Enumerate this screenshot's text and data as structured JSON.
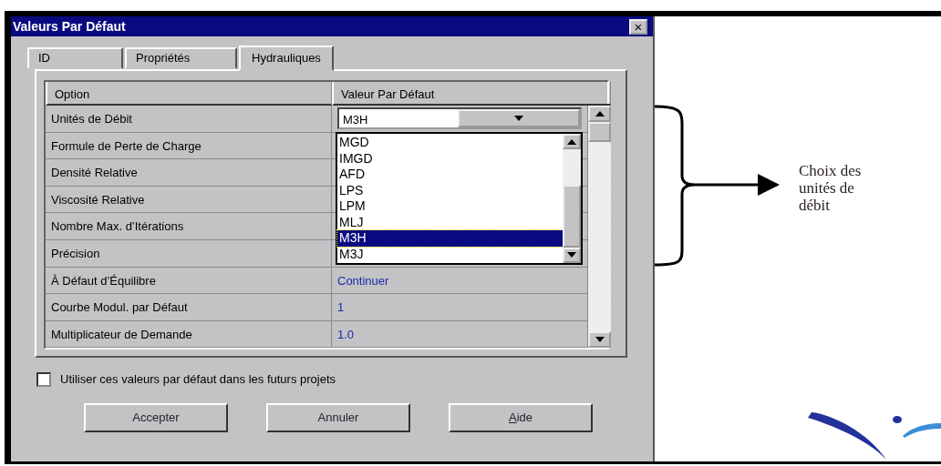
{
  "window": {
    "title": "Valeurs Par Défaut",
    "close": "×"
  },
  "tabs": [
    {
      "label": "ID",
      "selected": false
    },
    {
      "label": "Propriétés",
      "selected": false
    },
    {
      "label": "Hydrauliques",
      "selected": true
    }
  ],
  "grid": {
    "columns": [
      "Option",
      "Valeur Par Défaut"
    ],
    "rows": [
      {
        "option": "Unités de Débit",
        "value": "M3H",
        "kind": "combo"
      },
      {
        "option": "Formule de Perte de Charge"
      },
      {
        "option": "Densité Relative"
      },
      {
        "option": "Viscosité Relative"
      },
      {
        "option": "Nombre Max. d’Itérations"
      },
      {
        "option": "Précision"
      },
      {
        "option": "À Défaut d’Équilibre",
        "value": "Continuer",
        "kind": "text"
      },
      {
        "option": "Courbe Modul. par Défaut",
        "value": "1",
        "kind": "text"
      },
      {
        "option": "Multiplicateur de Demande",
        "value": "1.0",
        "kind": "text"
      }
    ]
  },
  "dropdown": {
    "items": [
      {
        "label": "MGD",
        "selected": false
      },
      {
        "label": "IMGD",
        "selected": false
      },
      {
        "label": "AFD",
        "selected": false
      },
      {
        "label": "LPS",
        "selected": false
      },
      {
        "label": "LPM",
        "selected": false
      },
      {
        "label": "MLJ",
        "selected": false
      },
      {
        "label": "M3H",
        "selected": true
      },
      {
        "label": "M3J",
        "selected": false
      }
    ]
  },
  "checkbox": {
    "label": "Utiliser ces valeurs  par défaut dans les futurs projets",
    "checked": false
  },
  "buttons": [
    "Accepter",
    "Annuler",
    "Aide"
  ],
  "annotation": {
    "text": "Choix des unités de débit"
  }
}
